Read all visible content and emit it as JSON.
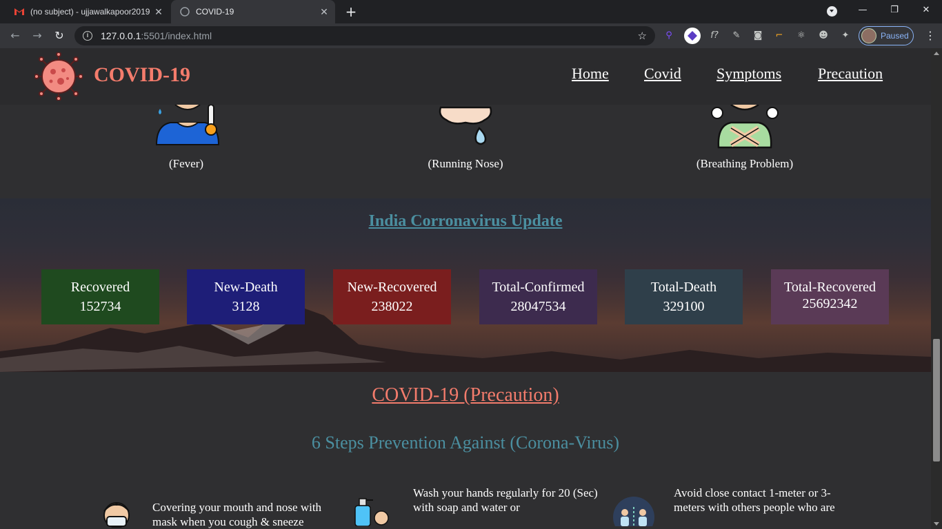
{
  "browser": {
    "tabs": [
      {
        "title": "(no subject) - ujjawalkapoor2019",
        "active": false
      },
      {
        "title": "COVID-19",
        "active": true
      }
    ],
    "url_host": "127.0.0.1",
    "url_rest": ":5501/index.html",
    "profile_label": "Paused"
  },
  "site": {
    "brand": "COVID-19",
    "nav": [
      "Home",
      "Covid",
      "Symptoms",
      "Precaution"
    ]
  },
  "symptoms": [
    {
      "caption": "(Fever)",
      "icon": "fever-icon"
    },
    {
      "caption": "(Running Nose)",
      "icon": "running-nose-icon"
    },
    {
      "caption": "(Breathing Problem)",
      "icon": "breathing-problem-icon"
    }
  ],
  "update": {
    "title": "India Corronavirus Update",
    "cards": [
      {
        "label": "Recovered",
        "value": "152734",
        "color": "#1f4a1f"
      },
      {
        "label": "New-Death",
        "value": "3128",
        "color": "#1e1e78"
      },
      {
        "label": "New-Recovered",
        "value": "238022",
        "color": "#7a1e1e"
      },
      {
        "label": "Total-Confirmed",
        "value": "28047534",
        "color": "#3d2b4e"
      },
      {
        "label": "Total-Death",
        "value": "329100",
        "color": "#2f3f4a"
      },
      {
        "label": "Total-Recovered",
        "value": "25692342",
        "color": "#5a3a56"
      }
    ]
  },
  "precaution": {
    "title": "COVID-19 (Precaution)",
    "subtitle": "6 Steps Prevention Against (Corona-Virus)",
    "steps": [
      {
        "text": "Covering your mouth and nose with mask when you cough & sneeze",
        "icon": "mask-icon"
      },
      {
        "text": "Wash your hands regularly for 20 (Sec) with soap and water or",
        "icon": "hand-wash-icon"
      },
      {
        "text": "Avoid close contact 1-meter or 3-meters with others people who are",
        "icon": "social-distance-icon"
      }
    ]
  }
}
